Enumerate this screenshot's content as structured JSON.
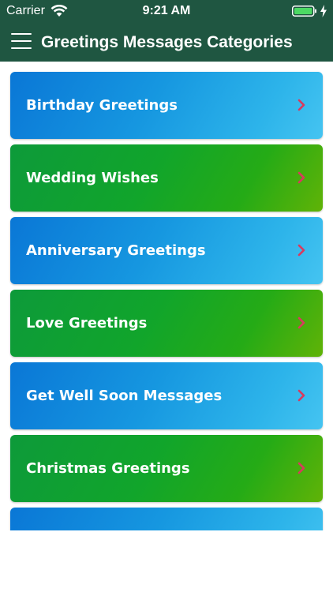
{
  "status_bar": {
    "carrier": "Carrier",
    "time": "9:21 AM",
    "wifi_icon": "wifi-icon",
    "battery_icon": "battery-icon",
    "charging_icon": "bolt-icon"
  },
  "header": {
    "title": "Greetings Messages Categories",
    "menu_icon": "hamburger-menu-icon",
    "background_color": "#1f5641"
  },
  "categories": [
    {
      "label": "Birthday Greetings",
      "style": "blue"
    },
    {
      "label": "Wedding Wishes",
      "style": "green"
    },
    {
      "label": "Anniversary Greetings",
      "style": "blue"
    },
    {
      "label": "Love Greetings",
      "style": "green"
    },
    {
      "label": "Get Well Soon Messages",
      "style": "blue"
    },
    {
      "label": "Christmas Greetings",
      "style": "green"
    },
    {
      "label": "",
      "style": "blue"
    }
  ],
  "colors": {
    "card_blue": "#1697e0",
    "card_green": "#11a52b",
    "chevron": "#d93a5e",
    "text": "#ffffff"
  }
}
